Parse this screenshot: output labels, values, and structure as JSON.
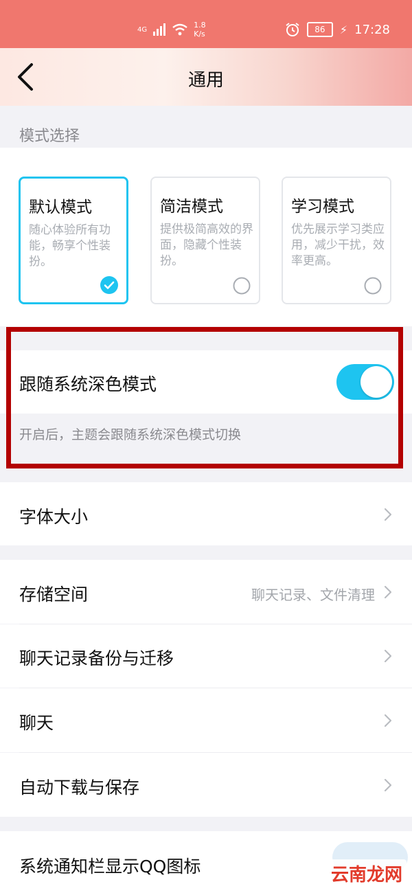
{
  "status_bar": {
    "network": "4G",
    "speed_value": "1.8",
    "speed_unit": "K/s",
    "battery": "86",
    "time": "17:28"
  },
  "nav": {
    "title": "通用"
  },
  "mode_section": {
    "header": "模式选择",
    "modes": [
      {
        "title": "默认模式",
        "desc": "随心体验所有功能，畅享个性装扮。",
        "selected": true
      },
      {
        "title": "简洁模式",
        "desc": "提供极简高效的界面，隐藏个性装扮。",
        "selected": false
      },
      {
        "title": "学习模式",
        "desc": "优先展示学习类应用，减少干扰，效率更高。",
        "selected": false
      }
    ]
  },
  "dark_mode": {
    "label": "跟随系统深色模式",
    "enabled": true,
    "hint": "开启后，主题会跟随系统深色模式切换"
  },
  "font_size": {
    "label": "字体大小"
  },
  "settings_list": [
    {
      "label": "存储空间",
      "sub": "聊天记录、文件清理"
    },
    {
      "label": "聊天记录备份与迁移",
      "sub": ""
    },
    {
      "label": "聊天",
      "sub": ""
    },
    {
      "label": "自动下载与保存",
      "sub": ""
    }
  ],
  "notify": {
    "label": "系统通知栏显示QQ图标"
  },
  "watermark": {
    "text": "云南龙网"
  },
  "colors": {
    "accent": "#1ec4f0",
    "status_bar": "#f0776e",
    "highlight_border": "#b30000"
  }
}
